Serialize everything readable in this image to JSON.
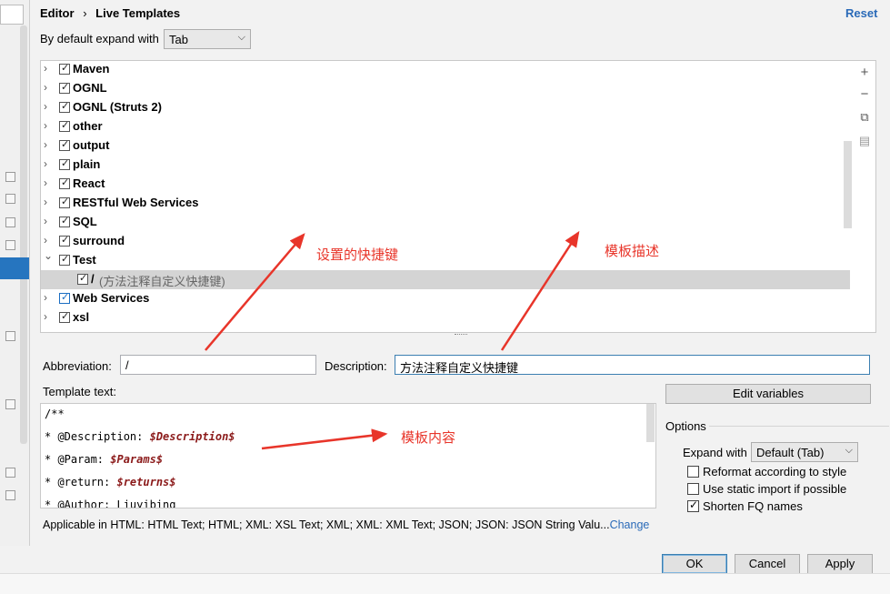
{
  "breadcrumb": {
    "first": "Editor",
    "separator": "›",
    "second": "Live Templates"
  },
  "reset_label": "Reset",
  "expand_default": {
    "label": "By default expand with",
    "value": "Tab"
  },
  "tree": {
    "groups": [
      {
        "label": "Maven",
        "expanded": false,
        "checked": true
      },
      {
        "label": "OGNL",
        "expanded": false,
        "checked": true
      },
      {
        "label": "OGNL (Struts 2)",
        "expanded": false,
        "checked": true
      },
      {
        "label": "other",
        "expanded": false,
        "checked": true
      },
      {
        "label": "output",
        "expanded": false,
        "checked": true
      },
      {
        "label": "plain",
        "expanded": false,
        "checked": true
      },
      {
        "label": "React",
        "expanded": false,
        "checked": true
      },
      {
        "label": "RESTful Web Services",
        "expanded": false,
        "checked": true
      },
      {
        "label": "SQL",
        "expanded": false,
        "checked": true
      },
      {
        "label": "surround",
        "expanded": false,
        "checked": true
      },
      {
        "label": "Test",
        "expanded": true,
        "checked": true
      },
      {
        "label": "Web Services",
        "expanded": false,
        "checked": true
      },
      {
        "label": "xsl",
        "expanded": false,
        "checked": true
      }
    ],
    "selected_template": {
      "abbreviation": "/",
      "description": "(方法注释自定义快捷键)"
    },
    "toolbar": [
      "add-icon",
      "remove-icon",
      "copy-icon",
      "restore-icon"
    ]
  },
  "abbreviation": {
    "label": "Abbreviation:",
    "value": "/"
  },
  "description": {
    "label": "Description:",
    "value": "方法注释自定义快捷键"
  },
  "template_text": {
    "label": "Template text:",
    "lines": [
      {
        "prefix": "/**",
        "var": ""
      },
      {
        "prefix": "* @Description: ",
        "var": "$Description$"
      },
      {
        "prefix": "* @Param: ",
        "var": "$Params$"
      },
      {
        "prefix": "* @return: ",
        "var": "$returns$"
      },
      {
        "prefix": "* @Author: Liuyibing",
        "var": ""
      }
    ]
  },
  "edit_variables_label": "Edit variables",
  "options": {
    "title": "Options",
    "expand_label": "Expand with",
    "expand_value": "Default (Tab)",
    "checkboxes": [
      {
        "label": "Reformat according to style",
        "checked": false
      },
      {
        "label": "Use static import if possible",
        "checked": false
      },
      {
        "label": "Shorten FQ names",
        "checked": true
      }
    ]
  },
  "applicable": {
    "text": "Applicable in HTML: HTML Text; HTML; XML: XSL Text; XML; XML: XML Text; JSON; JSON: JSON String Valu...",
    "link": "Change"
  },
  "buttons": {
    "ok": "OK",
    "cancel": "Cancel",
    "apply": "Apply"
  },
  "annotations": {
    "shortcut": "设置的快捷键",
    "description": "模板描述",
    "content": "模板内容"
  },
  "colors": {
    "accent": "#2a6ab8",
    "selection": "#2675bf",
    "annotation": "#e8352a",
    "template_var": "#8b1a1a"
  }
}
